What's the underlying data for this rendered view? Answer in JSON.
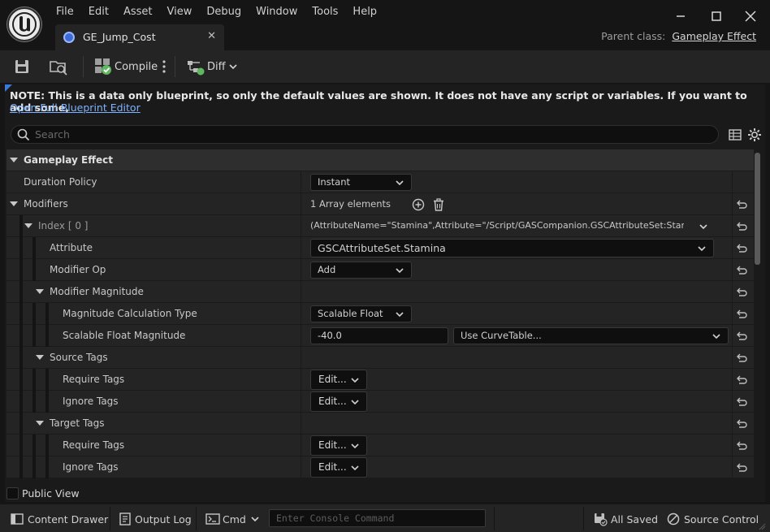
{
  "menu": [
    "File",
    "Edit",
    "Asset",
    "View",
    "Debug",
    "Window",
    "Tools",
    "Help"
  ],
  "tab": {
    "title": "GE_Jump_Cost",
    "close": "✕"
  },
  "parent_class": {
    "label": "Parent class:",
    "value": "Gameplay Effect"
  },
  "toolbar": {
    "compile_label": "Compile",
    "diff_label": "Diff"
  },
  "note": {
    "text": "NOTE: This is a data only blueprint, so only the default values are shown.  It does not have any script or variables.  If you want to add some,",
    "link": "Open Full Blueprint Editor"
  },
  "search": {
    "placeholder": "Search"
  },
  "details": {
    "category_gameplay_effect": "Gameplay Effect",
    "duration_policy": {
      "label": "Duration Policy",
      "value": "Instant"
    },
    "modifiers": {
      "label": "Modifiers",
      "count_text": "1 Array elements"
    },
    "index0": {
      "label": "Index [ 0 ]",
      "value": "(AttributeName=\"Stamina\",Attribute=\"/Script/GASCompanion.GSCAttributeSet:Stamina\",AttributeOwner=\"/Script/CoreUObject.Class'/Script/GASCompanion.GSCAttributeSet'\")"
    },
    "attribute": {
      "label": "Attribute",
      "value": "GSCAttributeSet.Stamina"
    },
    "modifier_op": {
      "label": "Modifier Op",
      "value": "Add"
    },
    "modifier_magnitude": {
      "label": "Modifier Magnitude"
    },
    "magnitude_calc_type": {
      "label": "Magnitude Calculation Type",
      "value": "Scalable Float"
    },
    "scalable_float_magnitude": {
      "label": "Scalable Float Magnitude",
      "value": "-40.0",
      "curve": "Use CurveTable..."
    },
    "source_tags": {
      "label": "Source Tags",
      "require": "Require Tags",
      "ignore": "Ignore Tags"
    },
    "target_tags": {
      "label": "Target Tags",
      "require": "Require Tags",
      "ignore": "Ignore Tags"
    },
    "edit_label": "Edit..."
  },
  "public_view": "Public View",
  "statusbar": {
    "content_drawer": "Content Drawer",
    "output_log": "Output Log",
    "cmd": "Cmd",
    "console_placeholder": "Enter Console Command",
    "all_saved": "All Saved",
    "source_control": "Source Control"
  },
  "colors": {
    "accent_blue": "#3c78d8",
    "link_blue": "#7fb2ff",
    "compile_green": "#5fb85f"
  }
}
